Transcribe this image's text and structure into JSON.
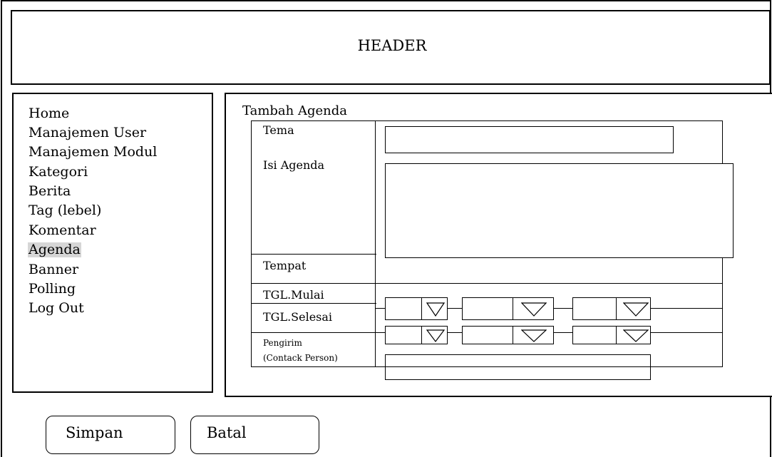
{
  "header": {
    "title": "HEADER"
  },
  "sidebar": {
    "items": [
      {
        "label": "Home",
        "active": false
      },
      {
        "label": "Manajemen User",
        "active": false
      },
      {
        "label": "Manajemen Modul",
        "active": false
      },
      {
        "label": "Kategori",
        "active": false
      },
      {
        "label": "Berita",
        "active": false
      },
      {
        "label": "Tag (lebel)",
        "active": false
      },
      {
        "label": "Komentar",
        "active": false
      },
      {
        "label": "Agenda",
        "active": true
      },
      {
        "label": "Banner",
        "active": false
      },
      {
        "label": "Polling",
        "active": false
      },
      {
        "label": "Log Out",
        "active": false
      }
    ]
  },
  "form": {
    "title": "Tambah Agenda",
    "labels": {
      "tema": "Tema",
      "isi_agenda": "Isi Agenda",
      "tempat": "Tempat",
      "tgl_mulai": "TGL.Mulai",
      "tgl_selesai": "TGL.Selesai",
      "pengirim_line1": "Pengirim",
      "pengirim_line2": "(Contack Person)"
    },
    "values": {
      "tema": "",
      "isi_agenda": "",
      "tempat": "",
      "pengirim": ""
    }
  },
  "actions": {
    "simpan": "Simpan",
    "batal": "Batal"
  },
  "icons": {
    "dropdown": "triangle-down-icon"
  },
  "colors": {
    "active_menu_bg": "#d6d6d6",
    "line": "#000000",
    "background": "#ffffff"
  }
}
